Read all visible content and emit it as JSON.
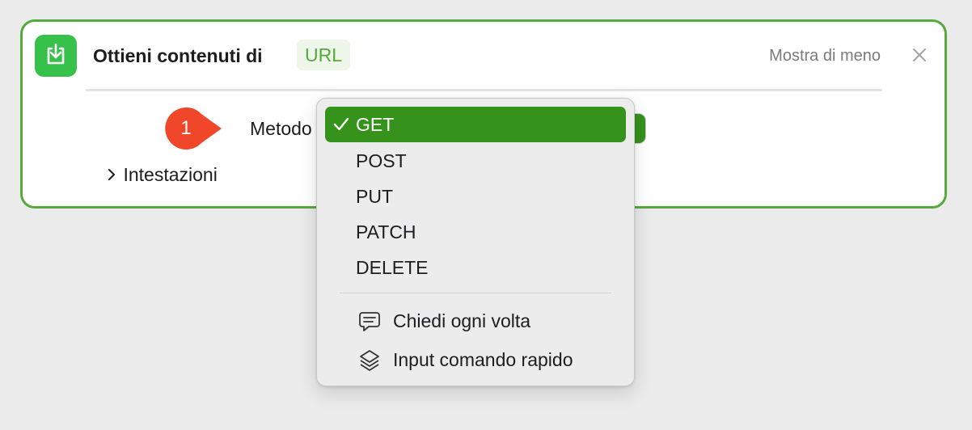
{
  "action": {
    "title": "Ottieni contenuti di",
    "parameter_token": "URL",
    "show_less": "Mostra di meno",
    "icon": "download-tray-icon",
    "accent_color": "#56a93c",
    "icon_color": "#35c14a"
  },
  "step": {
    "number": "1",
    "color": "#f0472a"
  },
  "fields": {
    "method_label": "Metodo",
    "method_value": "GET",
    "headers_label": "Intestazioni"
  },
  "menu": {
    "selected_color": "#35931c",
    "methods": [
      {
        "label": "GET",
        "selected": true
      },
      {
        "label": "POST",
        "selected": false
      },
      {
        "label": "PUT",
        "selected": false
      },
      {
        "label": "PATCH",
        "selected": false
      },
      {
        "label": "DELETE",
        "selected": false
      }
    ],
    "extra_options": [
      {
        "label": "Chiedi ogni volta",
        "icon": "speech-bubble-icon"
      },
      {
        "label": "Input comando rapido",
        "icon": "shortcut-layers-icon"
      }
    ]
  }
}
